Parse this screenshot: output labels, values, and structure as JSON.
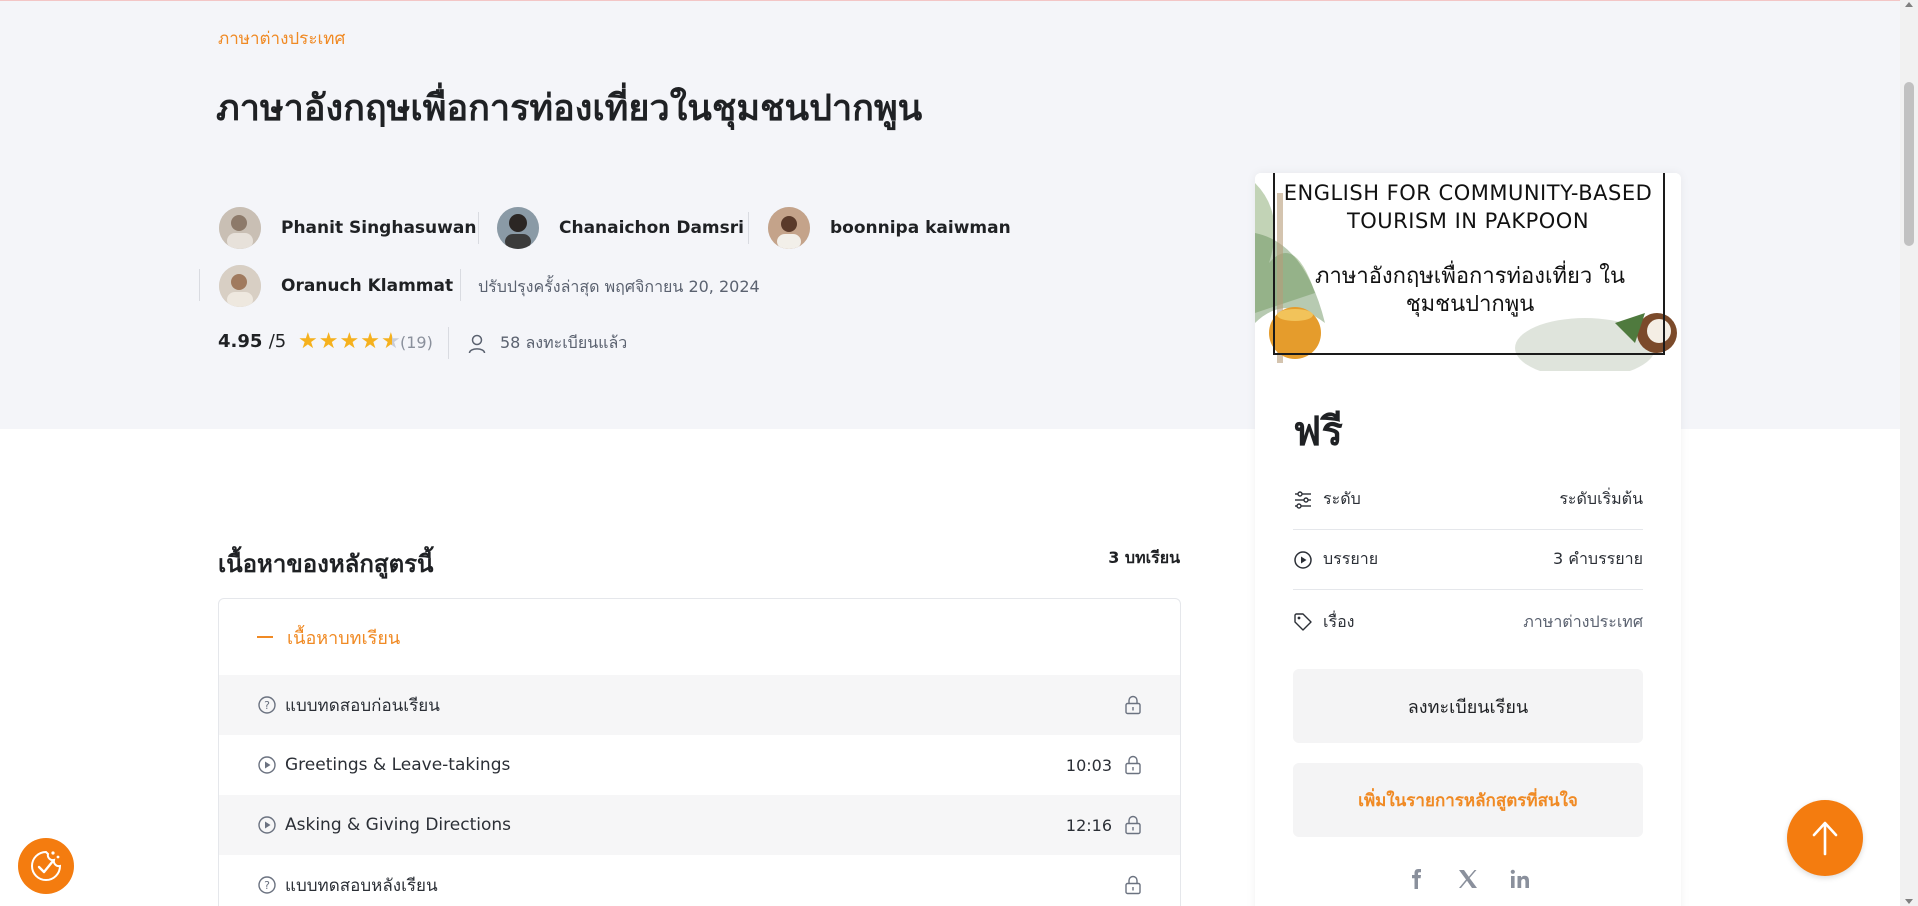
{
  "header": {
    "category": "ภาษาต่างประเทศ",
    "title": "ภาษาอังกฤษเพื่อการท่องเที่ยวในชุมชนปากพูน",
    "authors": [
      {
        "name": "Phanit Singhasuwan"
      },
      {
        "name": "Chanaichon Damsri"
      },
      {
        "name": "boonnipa kaiwman"
      },
      {
        "name": "Oranuch Klammat"
      }
    ],
    "updated": "ปรับปรุงครั้งล่าสุด พฤศจิกายน 20, 2024",
    "rating": "4.95",
    "rating_max": "/5",
    "rating_value": 4.95,
    "rating_count": "(19)",
    "enrolled": "58 ลงทะเบียนแล้ว"
  },
  "curriculum": {
    "title": "เนื้อหาของหลักสูตรนี้",
    "lesson_count": "3 บทเรียน",
    "topic": "เนื้อหาบทเรียน",
    "lessons": [
      {
        "name": "แบบทดสอบก่อนเรียน",
        "duration": "",
        "icon": "quiz-icon"
      },
      {
        "name": "Greetings & Leave-takings",
        "duration": "10:03",
        "icon": "play-icon"
      },
      {
        "name": "Asking & Giving Directions",
        "duration": "12:16",
        "icon": "play-icon"
      },
      {
        "name": "แบบทดสอบหลังเรียน",
        "duration": "",
        "icon": "quiz-icon"
      }
    ]
  },
  "card": {
    "thumbnail_en": "ENGLISH FOR COMMUNITY-BASED TOURISM IN PAKPOON",
    "thumbnail_th": "ภาษาอังกฤษเพื่อการท่องเที่ยว ในชุมชนปากพูน",
    "price": "ฟรี",
    "meta": [
      {
        "label": "ระดับ",
        "value": "ระดับเริ่มต้น",
        "icon": "sliders-icon"
      },
      {
        "label": "บรรยาย",
        "value": "3 คำบรรยาย",
        "icon": "play-circle-icon"
      },
      {
        "label": "เรื่อง",
        "value": "ภาษาต่างประเทศ",
        "icon": "tag-icon"
      }
    ],
    "enroll_label": "ลงทะเบียนเรียน",
    "wishlist_label": "เพิ่มในรายการหลักสูตรที่สนใจ",
    "social": [
      "facebook-icon",
      "x-icon",
      "linkedin-icon"
    ]
  },
  "colors": {
    "accent": "#f47c0f",
    "hero_bg": "#f4f5f9",
    "star": "#f5b11e"
  }
}
